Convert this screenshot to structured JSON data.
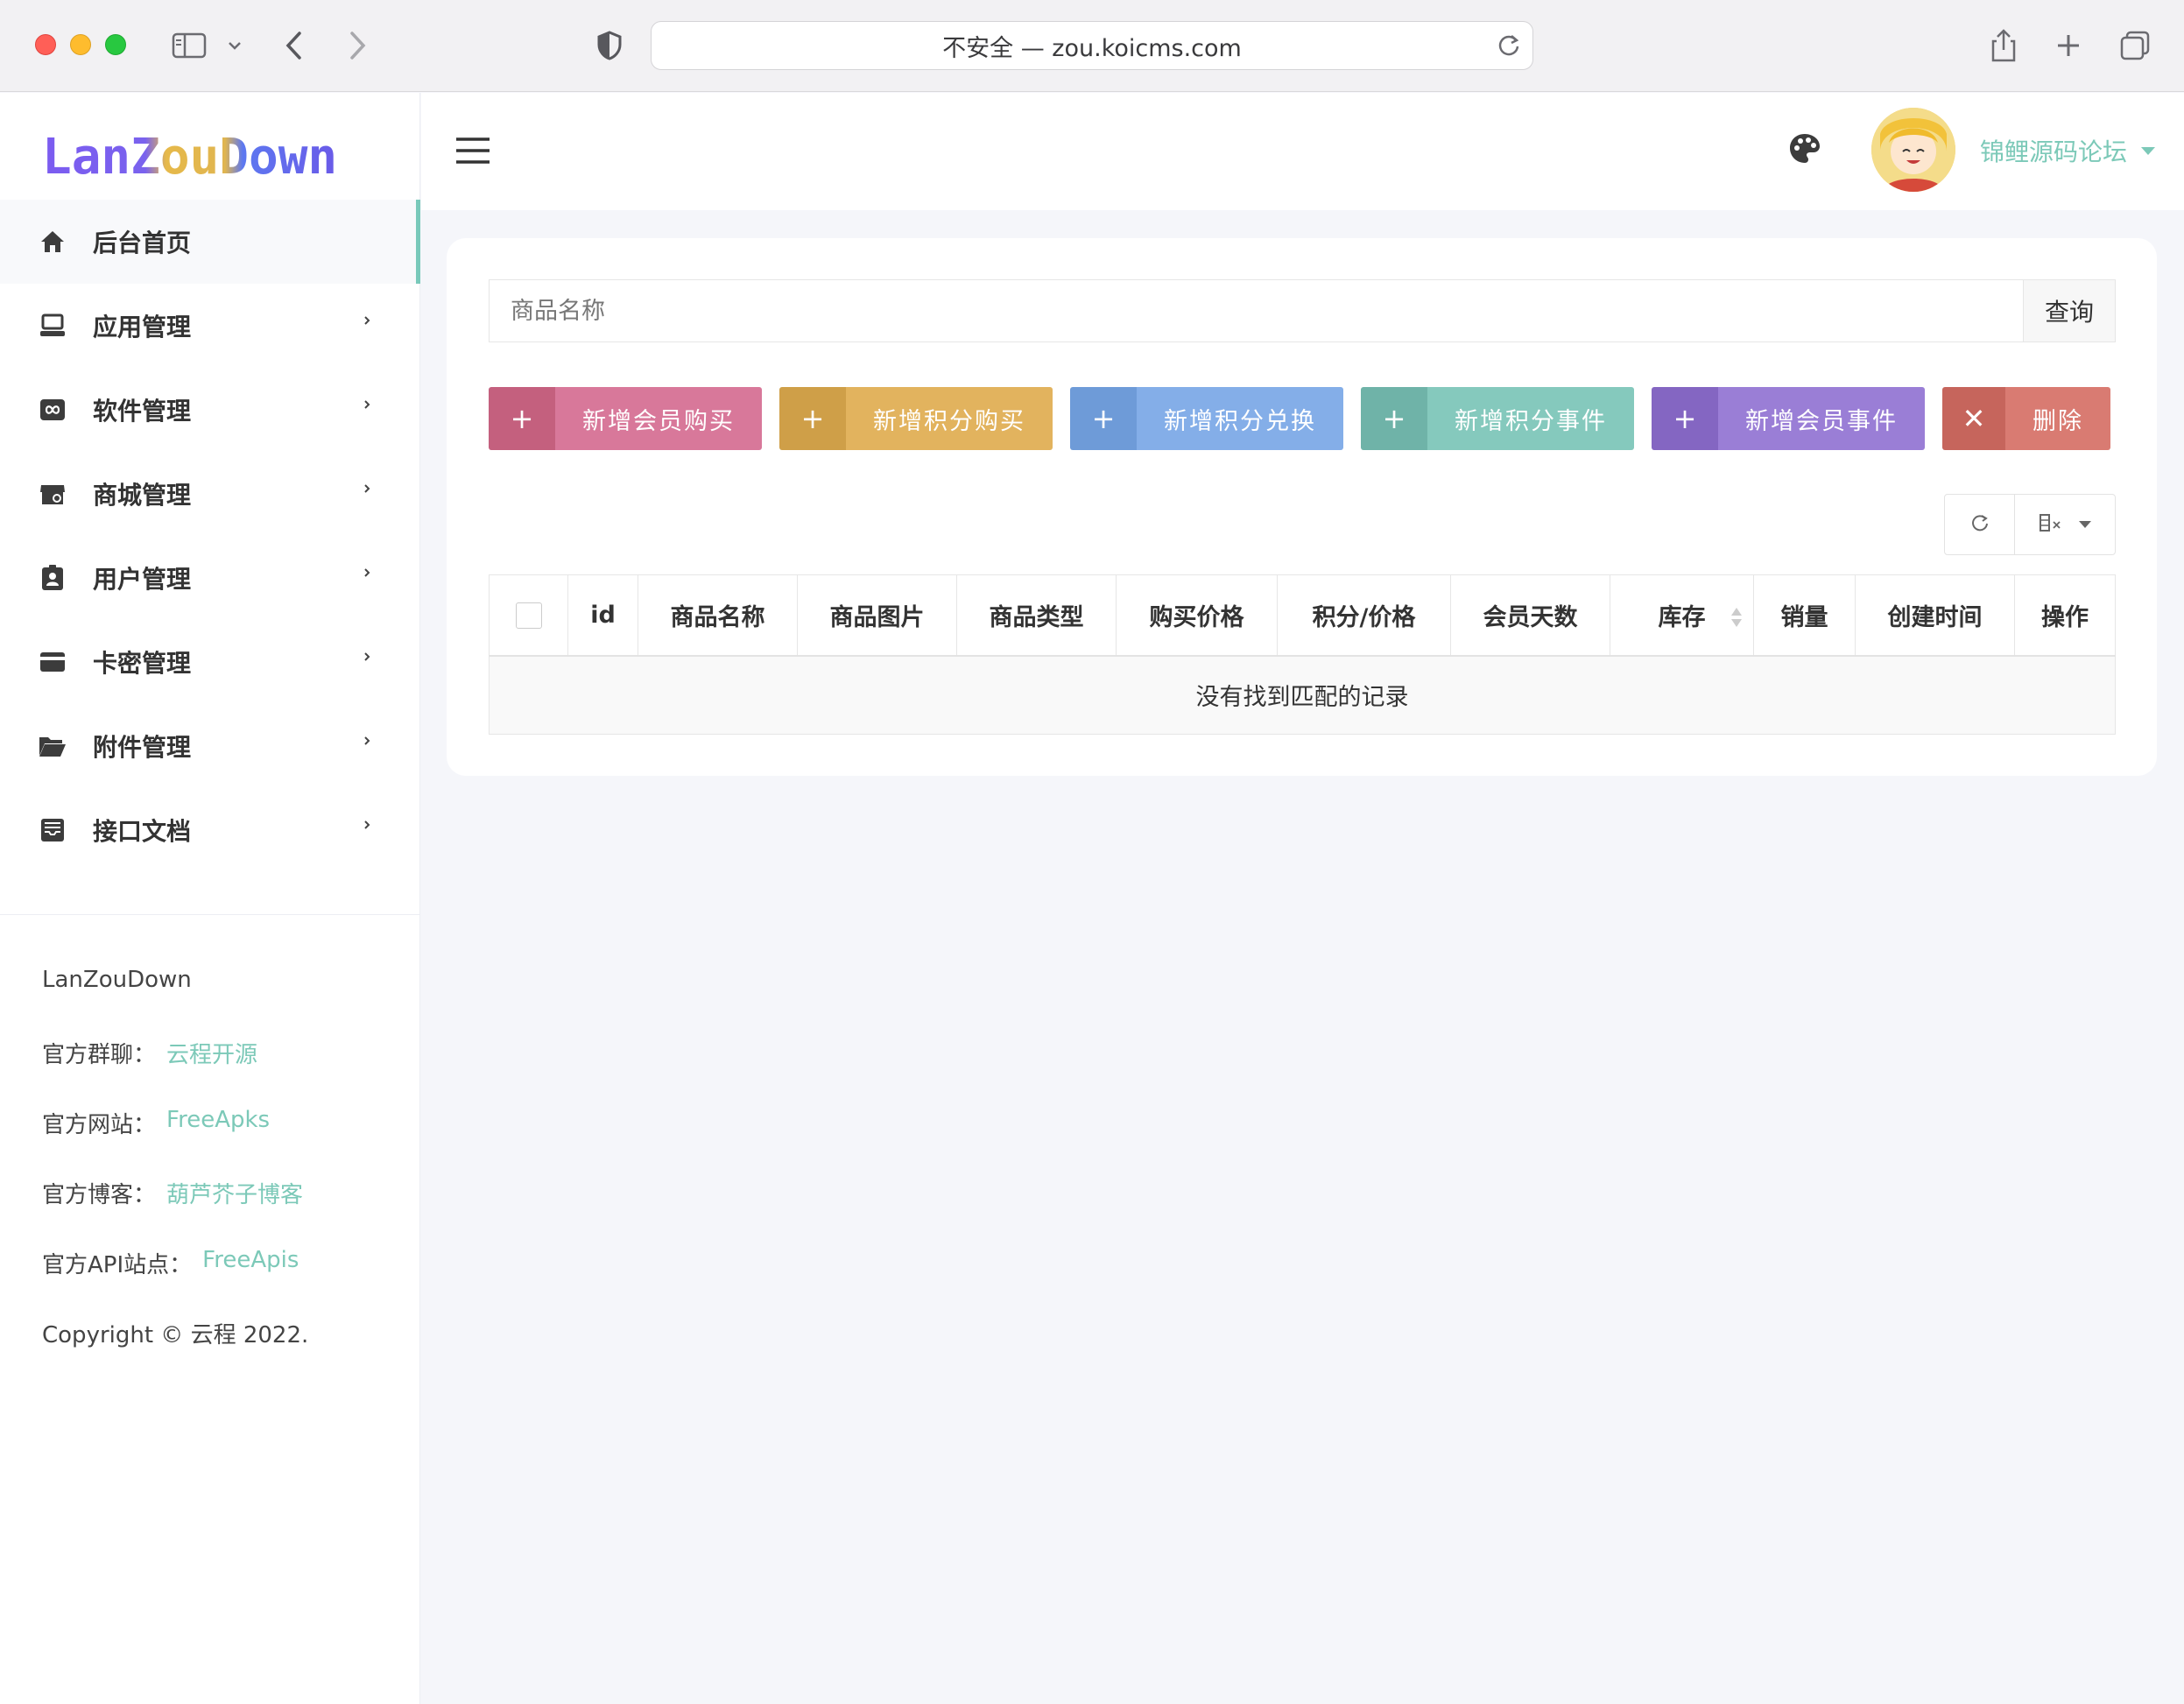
{
  "browser": {
    "url": "不安全 — zou.koicms.com"
  },
  "sidebar": {
    "logo_text": "LanZouDown",
    "menu": [
      {
        "label": "后台首页",
        "icon": "home-icon",
        "active": true
      },
      {
        "label": "应用管理",
        "icon": "laptop-icon"
      },
      {
        "label": "软件管理",
        "icon": "infinity-icon"
      },
      {
        "label": "商城管理",
        "icon": "shop-icon"
      },
      {
        "label": "用户管理",
        "icon": "id-badge-icon"
      },
      {
        "label": "卡密管理",
        "icon": "card-icon"
      },
      {
        "label": "附件管理",
        "icon": "folder-icon"
      },
      {
        "label": "接口文档",
        "icon": "inbox-icon"
      }
    ],
    "footer": {
      "brand": "LanZouDown",
      "group_label": "官方群聊：",
      "group_link": "云程开源",
      "site_label": "官方网站：",
      "site_link": "FreeApks",
      "blog_label": "官方博客：",
      "blog_link": "葫芦芥子博客",
      "api_label": "官方API站点：",
      "api_link": "FreeApis",
      "copyright": "Copyright © 云程 2022."
    }
  },
  "header": {
    "username": "锦鲤源码论坛"
  },
  "main": {
    "search": {
      "placeholder": "商品名称",
      "button": "查询"
    },
    "actions": [
      {
        "label": "新增会员购买",
        "icon": "+",
        "color_icon": "#c4607e",
        "color_label": "#d8789a"
      },
      {
        "label": "新增积分购买",
        "icon": "+",
        "color_icon": "#cf9f48",
        "color_label": "#e2b35e"
      },
      {
        "label": "新增积分兑换",
        "icon": "+",
        "color_icon": "#6e9bd8",
        "color_label": "#84aee8"
      },
      {
        "label": "新增积分事件",
        "icon": "+",
        "color_icon": "#6fb3a8",
        "color_label": "#85c9bd"
      },
      {
        "label": "新增会员事件",
        "icon": "+",
        "color_icon": "#8466c2",
        "color_label": "#9a7ed6"
      },
      {
        "label": "删除",
        "icon": "✕",
        "color_icon": "#c6655c",
        "color_label": "#d97b72"
      }
    ],
    "table": {
      "columns": [
        "id",
        "商品名称",
        "商品图片",
        "商品类型",
        "购买价格",
        "积分/价格",
        "会员天数",
        "库存",
        "销量",
        "创建时间",
        "操作"
      ],
      "empty_text": "没有找到匹配的记录"
    }
  },
  "colors": {
    "accent": "#79c9ba",
    "logo_gradient": [
      "#7b5cf0",
      "#e6b94a",
      "#5a7bf0"
    ]
  }
}
